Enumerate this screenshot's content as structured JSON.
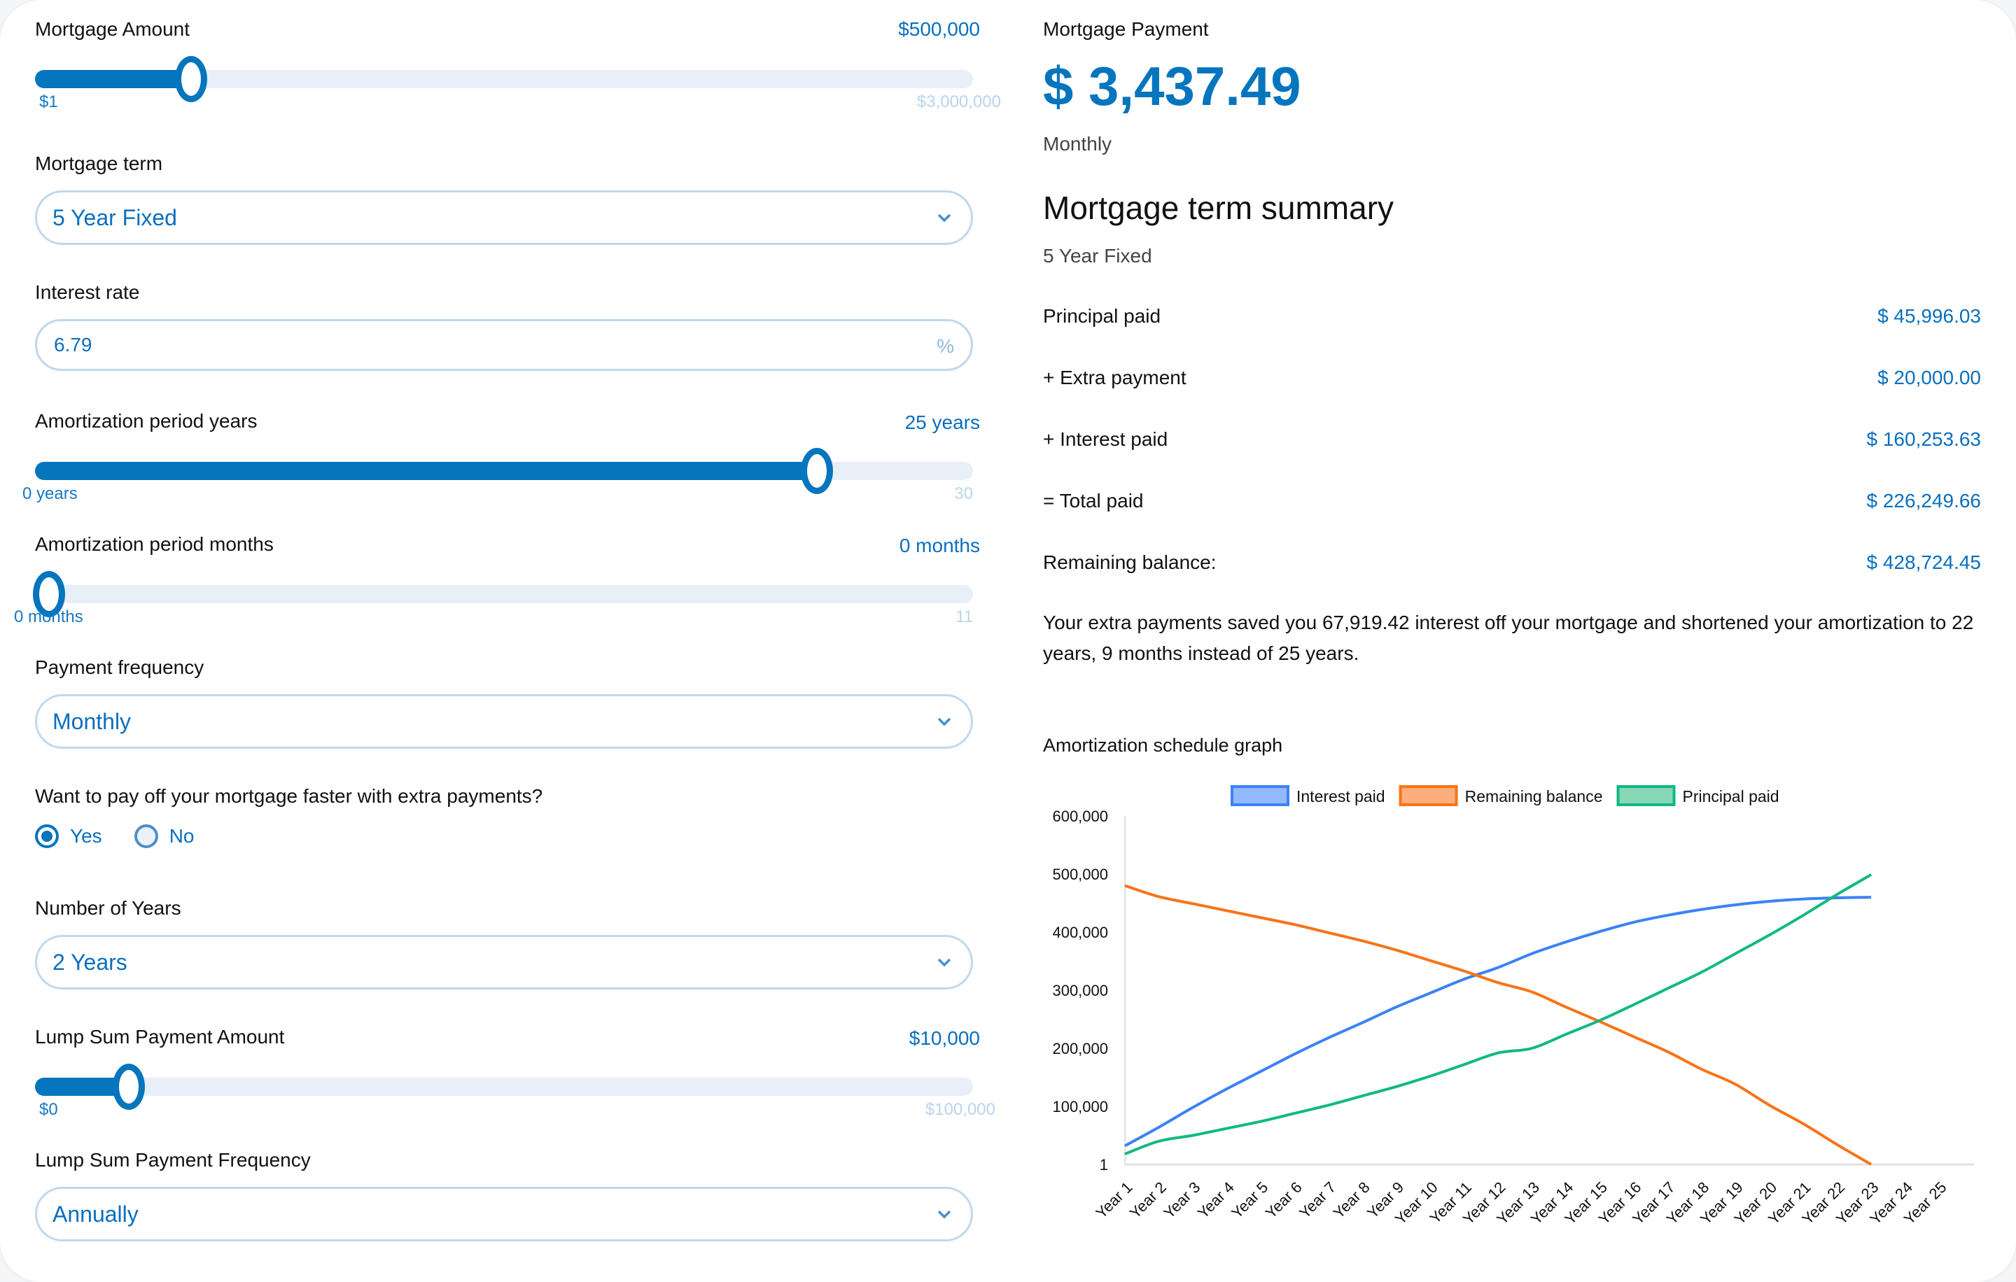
{
  "form": {
    "mortgage_amount": {
      "label": "Mortgage Amount",
      "value": "$500,000",
      "min": "$1",
      "max": "$3,000,000",
      "fraction": 0.1667
    },
    "mortgage_term": {
      "label": "Mortgage term",
      "selected": "5 Year Fixed"
    },
    "interest_rate": {
      "label": "Interest rate",
      "value": "6.79",
      "suffix": "%"
    },
    "amort_years": {
      "label": "Amortization period years",
      "value": "25 years",
      "min": "0 years",
      "max": "30",
      "fraction": 0.8333
    },
    "amort_months": {
      "label": "Amortization period months",
      "value": "0 months",
      "min": "0 months",
      "max": "11",
      "fraction": 0.0
    },
    "payment_frequency": {
      "label": "Payment frequency",
      "selected": "Monthly"
    },
    "extra_payments": {
      "question": "Want to pay off your mortgage faster with extra payments?",
      "options": [
        "Yes",
        "No"
      ],
      "selected": "Yes"
    },
    "number_of_years": {
      "label": "Number of Years",
      "selected": "2 Years"
    },
    "lump_sum_amount": {
      "label": "Lump Sum Payment Amount",
      "value": "$10,000",
      "min": "$0",
      "max": "$100,000",
      "fraction": 0.1
    },
    "lump_sum_frequency": {
      "label": "Lump Sum Payment Frequency",
      "selected": "Annually"
    }
  },
  "results": {
    "payment_title": "Mortgage Payment",
    "payment_amount": "$ 3,437.49",
    "payment_period": "Monthly",
    "summary_title": "Mortgage term summary",
    "summary_term": "5 Year Fixed",
    "rows": [
      {
        "label": "Principal paid",
        "value": "$  45,996.03"
      },
      {
        "label": "+ Extra payment",
        "value": "$  20,000.00"
      },
      {
        "label": "+ Interest paid",
        "value": "$  160,253.63"
      },
      {
        "label": "= Total paid",
        "value": "$  226,249.66"
      },
      {
        "label": "Remaining balance:",
        "value": "$  428,724.45"
      }
    ],
    "note": "Your extra payments saved you 67,919.42 interest off your mortgage and shortened your amortization to 22 years, 9 months instead of 25 years.",
    "chart_title": "Amortization schedule graph"
  },
  "colors": {
    "accent": "#0575bd",
    "interest": "#3b82f6",
    "balance": "#f97316",
    "principal": "#10b981"
  },
  "chart_data": {
    "type": "line",
    "title": "Amortization schedule graph",
    "xlabel": "",
    "ylabel": "",
    "legend_position": "top-center",
    "grid": false,
    "ylim": [
      1,
      600000
    ],
    "yticks": [
      "1",
      "100,000",
      "200,000",
      "300,000",
      "400,000",
      "500,000",
      "600,000"
    ],
    "ytick_values": [
      1,
      100000,
      200000,
      300000,
      400000,
      500000,
      600000
    ],
    "categories": [
      "Year 1",
      "Year 2",
      "Year 3",
      "Year 4",
      "Year 5",
      "Year 6",
      "Year 7",
      "Year 8",
      "Year 9",
      "Year 10",
      "Year 11",
      "Year 12",
      "Year 13",
      "Year 14",
      "Year 15",
      "Year 16",
      "Year 17",
      "Year 18",
      "Year 19",
      "Year 20",
      "Year 21",
      "Year 22",
      "Year 23",
      "Year 24",
      "Year 25"
    ],
    "series": [
      {
        "name": "Interest paid",
        "color": "#3b82f6",
        "values": [
          32000,
          64000,
          98000,
          130000,
          160000,
          190000,
          218000,
          244000,
          271000,
          295000,
          319000,
          339000,
          363000,
          383000,
          401000,
          417000,
          429000,
          439000,
          447000,
          453000,
          457000,
          459000,
          460000
        ]
      },
      {
        "name": "Remaining balance",
        "color": "#f97316",
        "values": [
          480000,
          461000,
          449000,
          437000,
          425000,
          413000,
          399000,
          385000,
          369000,
          351000,
          333000,
          313000,
          297000,
          271000,
          246000,
          220000,
          194000,
          164000,
          138000,
          102000,
          70000,
          34000,
          0
        ]
      },
      {
        "name": "Principal paid",
        "color": "#10b981",
        "values": [
          18000,
          40000,
          50000,
          62000,
          74000,
          88000,
          102000,
          118000,
          134000,
          152000,
          172000,
          192000,
          200000,
          224000,
          248000,
          275000,
          303000,
          331000,
          363000,
          395000,
          429000,
          465000,
          499000
        ]
      }
    ]
  }
}
